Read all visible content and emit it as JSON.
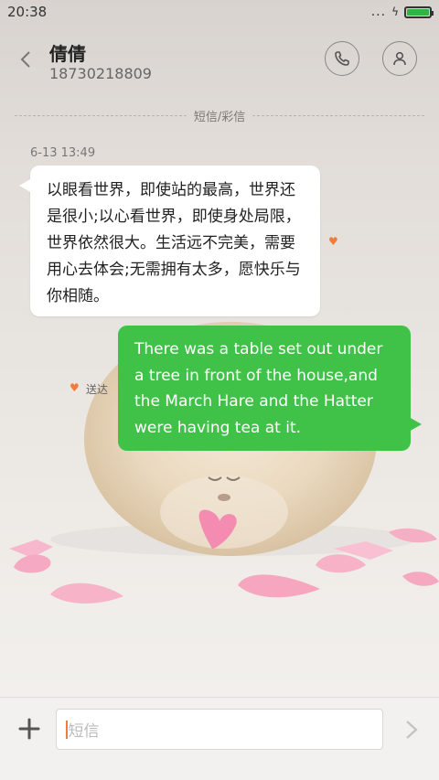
{
  "status_bar": {
    "time": "20:38",
    "dots": "...",
    "charging_icon": "bolt-icon",
    "battery_icon": "battery-icon",
    "battery_level": 1.0,
    "battery_color": "#2fb540"
  },
  "header": {
    "contact_name": "倩倩",
    "contact_number": "18730218809",
    "back_icon": "chevron-left-icon",
    "call_icon": "phone-icon",
    "contact_icon": "person-icon"
  },
  "thread": {
    "channel_label": "短信/彩信",
    "timestamp": "6-13 13:49",
    "incoming_message": "以眼看世界，即使站的最高，世界还是很小;以心看世界，即使身处局限，世界依然很大。生活远不完美，需要用心去体会;无需拥有太多，愿快乐与你相随。",
    "outgoing_message": "There was a table set out under a tree in front of the house,and the March Hare and the Hatter were having tea at it.",
    "outgoing_status": "送达",
    "accent_color": "#f07c3c",
    "outgoing_bubble_color": "#40c249"
  },
  "composer": {
    "placeholder": "短信",
    "add_icon": "plus-icon",
    "send_icon": "chevron-right-icon"
  }
}
